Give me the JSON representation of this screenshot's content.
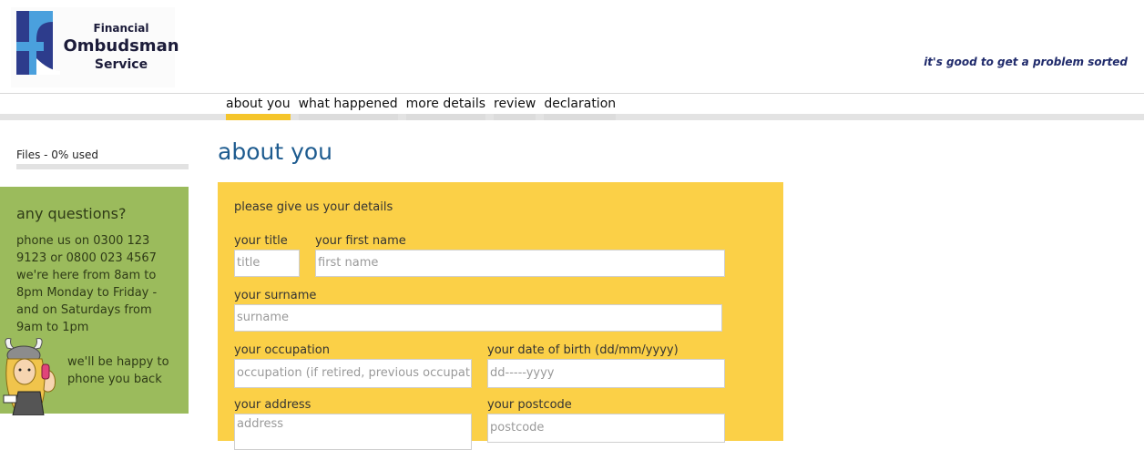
{
  "header": {
    "logo_line1": "Financial",
    "logo_line2": "Ombudsman",
    "logo_line3": "Service",
    "tagline": "it's good to get a problem sorted"
  },
  "nav": {
    "items": [
      {
        "label": "about you",
        "active": true
      },
      {
        "label": "what happened",
        "active": false
      },
      {
        "label": "more details",
        "active": false
      },
      {
        "label": "review",
        "active": false
      },
      {
        "label": "declaration",
        "active": false
      }
    ]
  },
  "sidebar": {
    "files_label": "Files - 0% used",
    "files_used_percent": 0,
    "questions_title": "any questions?",
    "questions_body": "phone us on 0300 123 9123 or 0800 023 4567 we're here from 8am to 8pm Monday to Friday - and on Saturdays from 9am to 1pm",
    "callback_text": "we'll be happy to phone you back"
  },
  "main": {
    "title": "about you",
    "intro": "please give us your details",
    "fields": {
      "title": {
        "label": "your title",
        "placeholder": "title"
      },
      "first_name": {
        "label": "your first name",
        "placeholder": "first name"
      },
      "surname": {
        "label": "your surname",
        "placeholder": "surname"
      },
      "occupation": {
        "label": "your occupation",
        "placeholder": "occupation (if retired, previous occupation)"
      },
      "dob": {
        "label": "your date of birth (dd/mm/yyyy)",
        "placeholder": "dd-----yyyy"
      },
      "address": {
        "label": "your address",
        "placeholder": "address"
      },
      "postcode": {
        "label": "your postcode",
        "placeholder": "postcode"
      }
    }
  },
  "colors": {
    "accent_yellow": "#fbd047",
    "sidebar_green": "#9bbb5c",
    "title_blue": "#1d5b8f"
  }
}
